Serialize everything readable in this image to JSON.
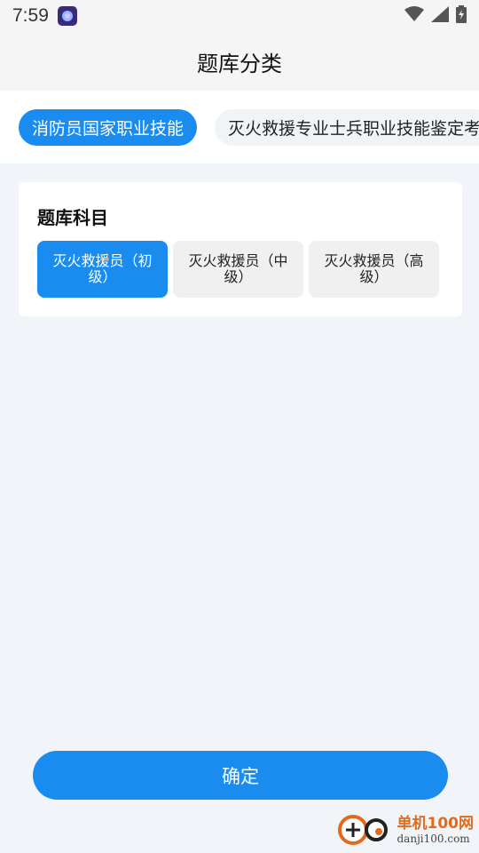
{
  "status_bar": {
    "time": "7:59",
    "icons": [
      "app-notification-icon",
      "wifi-icon",
      "signal-icon",
      "battery-charging-icon"
    ]
  },
  "header": {
    "title": "题库分类"
  },
  "categories": [
    {
      "label": "消防员国家职业技能",
      "active": true
    },
    {
      "label": "灭火救援专业士兵职业技能鉴定考",
      "active": false
    }
  ],
  "subject_card": {
    "title": "题库科目",
    "subjects": [
      {
        "label": "灭火救援员（初级）",
        "active": true
      },
      {
        "label": "灭火救援员（中级）",
        "active": false
      },
      {
        "label": "灭火救援员（高级）",
        "active": false
      }
    ]
  },
  "confirm": {
    "label": "确定"
  },
  "watermark": {
    "name": "单机100网",
    "url": "danji100.com"
  },
  "colors": {
    "accent": "#1a8cf0",
    "background": "#f1f5f9",
    "inactive": "#f0f0f0",
    "watermark": "#e36a1a"
  }
}
